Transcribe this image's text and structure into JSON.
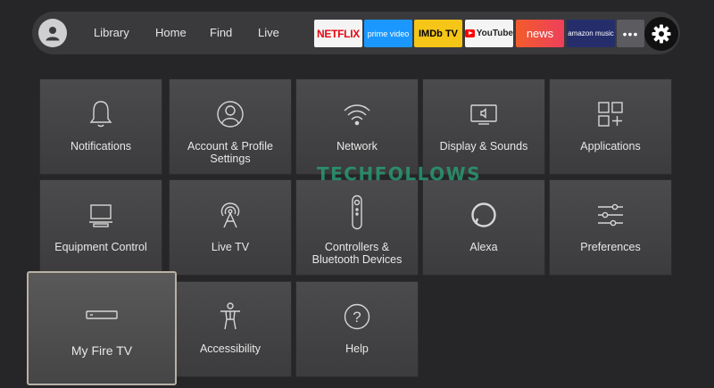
{
  "nav": {
    "items": [
      {
        "label": "Library"
      },
      {
        "label": "Home"
      },
      {
        "label": "Find"
      },
      {
        "label": "Live"
      }
    ]
  },
  "apps": [
    {
      "name": "NETFLIX",
      "color": "#e50914"
    },
    {
      "name": "prime video",
      "color": "#1a98ff"
    },
    {
      "name": "IMDb TV",
      "color": "#f5c518"
    },
    {
      "name": "YouTube",
      "color": "#ff0000"
    },
    {
      "name": "news",
      "color": "#f25c2b"
    },
    {
      "name": "amazon music",
      "color": "#252e6b"
    }
  ],
  "more_label": "•••",
  "settings": {
    "tiles": [
      {
        "label": "Notifications",
        "icon": "bell-icon"
      },
      {
        "label": "Account & Profile Settings",
        "icon": "account-icon"
      },
      {
        "label": "Network",
        "icon": "wifi-icon"
      },
      {
        "label": "Display & Sounds",
        "icon": "display-icon"
      },
      {
        "label": "Applications",
        "icon": "apps-grid-icon"
      },
      {
        "label": "Equipment Control",
        "icon": "tv-equipment-icon"
      },
      {
        "label": "Live TV",
        "icon": "antenna-icon"
      },
      {
        "label": "Controllers & Bluetooth Devices",
        "icon": "remote-icon"
      },
      {
        "label": "Alexa",
        "icon": "alexa-icon"
      },
      {
        "label": "Preferences",
        "icon": "sliders-icon"
      },
      {
        "label": "My Fire TV",
        "icon": "fire-tv-device-icon",
        "focused": true
      },
      {
        "label": "Accessibility",
        "icon": "accessibility-icon"
      },
      {
        "label": "Help",
        "icon": "help-icon"
      }
    ]
  },
  "watermark": "TECHFOLLOWS"
}
